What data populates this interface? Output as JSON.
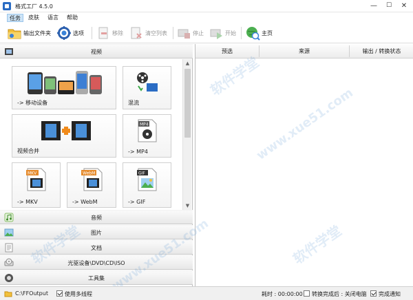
{
  "window": {
    "title": "格式工厂 4.5.0",
    "controls": [
      "—",
      "☐",
      "✕"
    ]
  },
  "menu": [
    "任务",
    "皮肤",
    "语言",
    "帮助"
  ],
  "toolbar": {
    "output_folder": "输出文件夹",
    "options": "选项",
    "remove": "移除",
    "clear_list": "清空列表",
    "stop": "停止",
    "start": "开始",
    "home": "主页"
  },
  "categories": {
    "video": "视频",
    "audio": "音频",
    "image": "图片",
    "document": "文档",
    "disc": "光驱设备\\DVD\\CD\\ISO",
    "tools": "工具集"
  },
  "tiles": [
    {
      "label": "-> 移动设备",
      "icon": "mobile-devices-icon"
    },
    {
      "label": "混流",
      "icon": "mux-icon"
    },
    {
      "label": "视频合并",
      "icon": "video-join-icon"
    },
    {
      "label": "-> MP4",
      "icon": "mp4-file-icon"
    },
    {
      "label": "-> MKV",
      "icon": "mkv-file-icon"
    },
    {
      "label": "-> WebM",
      "icon": "webm-file-icon"
    },
    {
      "label": "-> GIF",
      "icon": "gif-file-icon"
    }
  ],
  "file_badges": {
    "mp4": "MP4",
    "mkv": "MKV",
    "webm": "WebM",
    "gif": "GIF"
  },
  "list_columns": [
    "预选",
    "来源",
    "输出 / 转换状态"
  ],
  "status": {
    "output_path": "C:\\FFOutput",
    "multithread_label": "使用多线程",
    "multithread_checked": true,
    "elapsed_label": "耗时 : 00:00:00",
    "after_done_label": "转换完成后 : 关闭电脑",
    "after_done_checked": false,
    "notify_label": "完成通知",
    "notify_checked": true
  },
  "watermark": "软件学堂",
  "watermark_url": "www.xue51.com",
  "colors": {
    "accent": "#2a6cc4",
    "menu_active": "#cde4f7"
  }
}
